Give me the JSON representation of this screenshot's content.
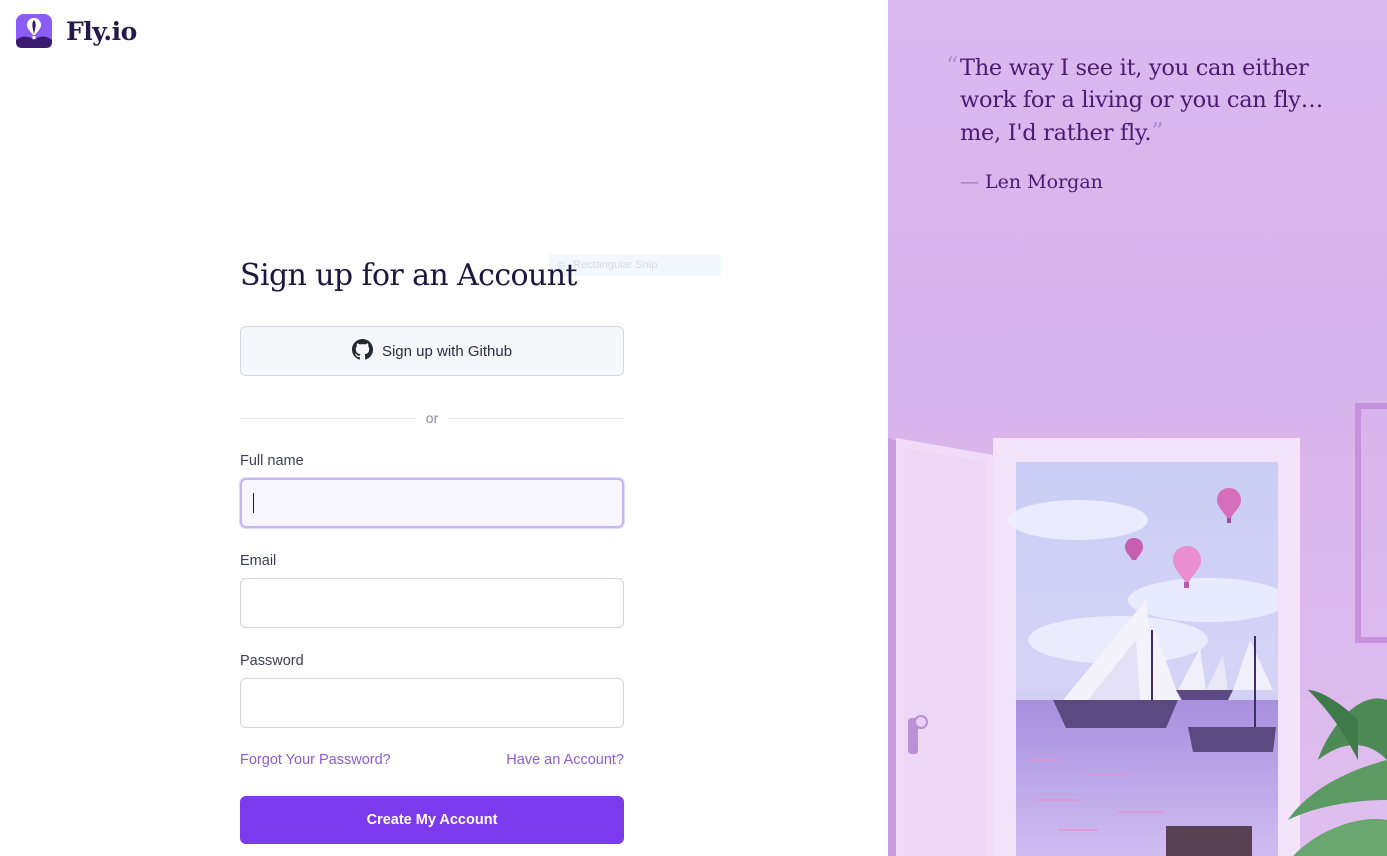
{
  "brand": {
    "name": "Fly.io",
    "accent": "#7c3aed"
  },
  "overlay": {
    "snip_label": "Rectangular Snip"
  },
  "form": {
    "title": "Sign up for an Account",
    "github_button": "Sign up with Github",
    "divider": "or",
    "full_name": {
      "label": "Full name",
      "value": "",
      "placeholder": ""
    },
    "email": {
      "label": "Email",
      "value": "",
      "placeholder": ""
    },
    "password": {
      "label": "Password",
      "value": "",
      "placeholder": ""
    },
    "forgot_link": "Forgot Your Password?",
    "login_link": "Have an Account?",
    "submit": "Create My Account"
  },
  "quote": {
    "open_mark": "“",
    "text": "The way I see it, you can either work for a living or you can fly… me, I'd rather fly.",
    "close_mark": "”",
    "author_dash": "—",
    "author": "Len Morgan"
  },
  "icons": {
    "logo": "balloon-logo-icon",
    "github": "github-icon"
  },
  "colors": {
    "panel_background": "#dcb8ee",
    "quote_text": "#4a1a73",
    "link": "#8b5cd6"
  }
}
